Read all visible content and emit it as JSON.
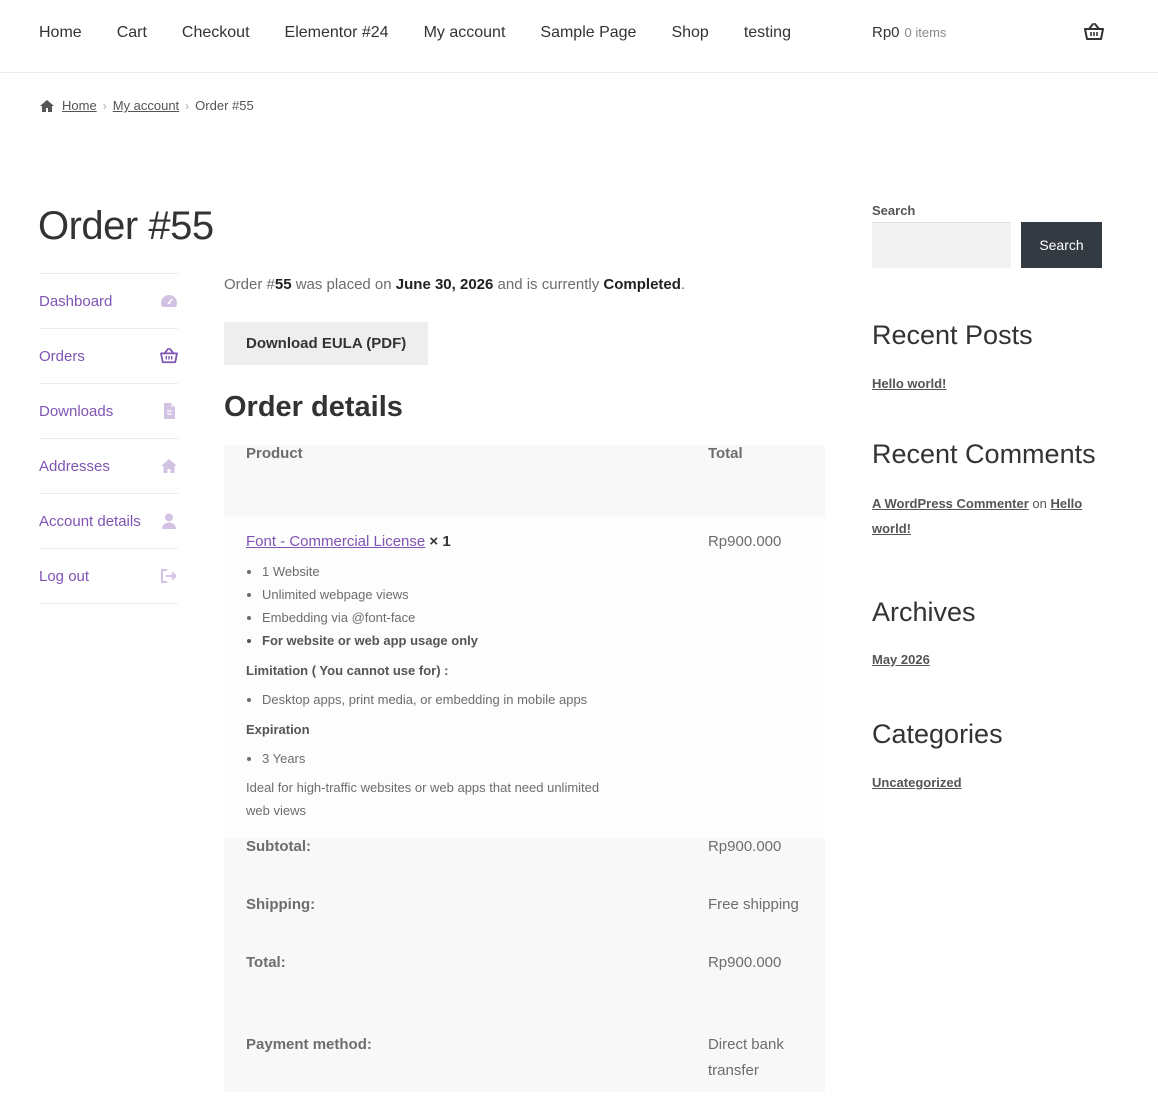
{
  "header": {
    "nav": [
      "Home",
      "Cart",
      "Checkout",
      "Elementor #24",
      "My account",
      "Sample Page",
      "Shop",
      "testing"
    ],
    "cart_total": "Rp0",
    "cart_count": "0 items",
    "cart_icon": "basket-icon"
  },
  "breadcrumb": {
    "home": "Home",
    "my_account": "My account",
    "current": "Order #55"
  },
  "page_title": "Order #55",
  "account_nav": [
    {
      "label": "Dashboard",
      "icon": "dashboard-icon"
    },
    {
      "label": "Orders",
      "icon": "basket-icon"
    },
    {
      "label": "Downloads",
      "icon": "file-icon"
    },
    {
      "label": "Addresses",
      "icon": "home-icon"
    },
    {
      "label": "Account details",
      "icon": "user-icon"
    },
    {
      "label": "Log out",
      "icon": "logout-icon"
    }
  ],
  "order": {
    "intro_prefix": "Order #",
    "number": "55",
    "intro_mid": " was placed on ",
    "date": "June 30, 2026",
    "intro_mid2": " and is currently ",
    "status": "Completed",
    "intro_suffix": ".",
    "download_button": "Download EULA (PDF)",
    "details_title": "Order details"
  },
  "table": {
    "col_product": "Product",
    "col_total": "Total",
    "item": {
      "name": "Font - Commercial License",
      "qty": "× 1",
      "total": "Rp900.000",
      "features": [
        "1 Website",
        "Unlimited webpage views",
        "Embedding via @font-face"
      ],
      "feature_bold": "For website or web app usage only",
      "limitation_heading": "Limitation ( You cannot use for) :",
      "limitations": [
        "Desktop apps, print media, or embedding in mobile apps"
      ],
      "expiration_heading": "Expiration",
      "expirations": [
        "3 Years"
      ],
      "description": "Ideal for high-traffic websites or web apps that need unlimited web views"
    },
    "subtotal_label": "Subtotal:",
    "subtotal_value": "Rp900.000",
    "shipping_label": "Shipping:",
    "shipping_value": "Free shipping",
    "total_label": "Total:",
    "total_value": "Rp900.000",
    "payment_label": "Payment method:",
    "payment_value": "Direct bank transfer"
  },
  "sidebar": {
    "search_label": "Search",
    "search_button": "Search",
    "recent_posts_title": "Recent Posts",
    "recent_post": "Hello world!",
    "recent_comments_title": "Recent Comments",
    "comment_author": "A WordPress Commenter",
    "comment_on": " on ",
    "comment_post": "Hello world!",
    "archives_title": "Archives",
    "archive_item": "May 2026",
    "categories_title": "Categories",
    "category_item": "Uncategorized"
  },
  "colors": {
    "accent": "#7f54b3",
    "button_dark": "#333a42",
    "table_bg": "#f8f8f8"
  }
}
